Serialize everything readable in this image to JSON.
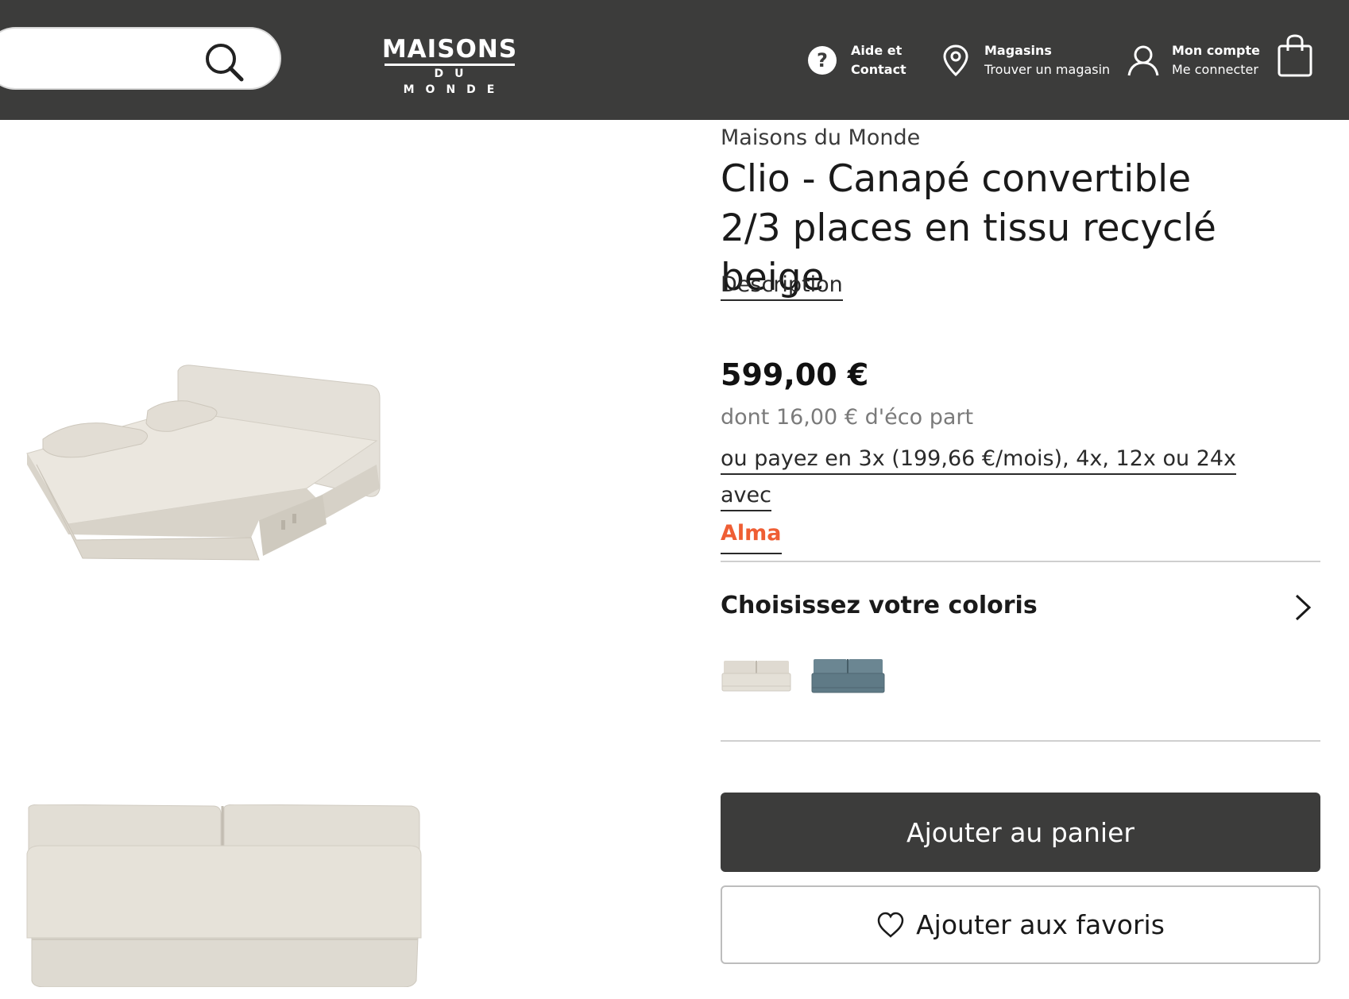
{
  "header": {
    "search": {
      "placeholder": ""
    },
    "logo": {
      "top": "MAISONS",
      "bottom": "DU MONDE"
    },
    "nav": {
      "aide": {
        "line1": "Aide et",
        "line2": "Contact",
        "icon": "help-icon"
      },
      "magasins": {
        "line1": "Magasins",
        "line2": "Trouver un magasin",
        "icon": "location-pin-icon"
      },
      "compte": {
        "line1": "Mon compte",
        "line2": "Me connecter",
        "icon": "user-icon"
      },
      "cart": {
        "icon": "shopping-bag-icon"
      }
    },
    "colors": {
      "background": "#3c3c3b",
      "text": "#ffffff"
    }
  },
  "product": {
    "brand": "Maisons du Monde",
    "title": "Clio - Canapé convertible 2/3 places en tissu recyclé beige",
    "description_link": "Description",
    "price": "599,00 €",
    "eco_part": "dont 16,00 € d'éco part",
    "payment_text": "ou payez en 3x (199,66 €/mois), 4x, 12x ou 24x avec",
    "payment_brand": "Alma",
    "payment_brand_color": "#ef5e34",
    "coloris": {
      "label": "Choisissez votre coloris",
      "icon": "chevron-right-icon",
      "swatches": [
        {
          "color": "beige",
          "hex": "#d9d3c8"
        },
        {
          "color": "bleu",
          "hex": "#5f7a86"
        }
      ]
    },
    "actions": {
      "add_to_cart": "Ajouter au panier",
      "add_to_favorites": "Ajouter aux favoris",
      "favorites_icon": "heart-icon"
    }
  }
}
